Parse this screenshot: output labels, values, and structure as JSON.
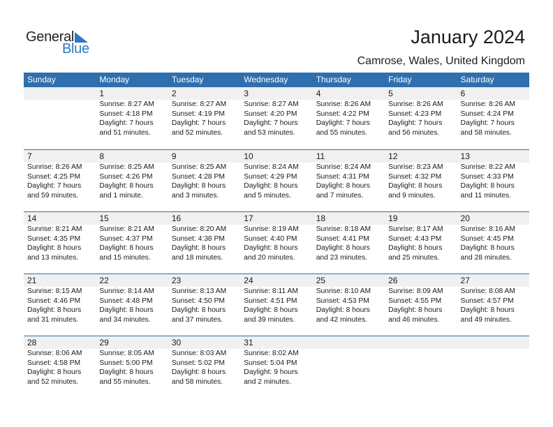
{
  "logo": {
    "general": "General",
    "blue": "Blue",
    "icon": "triangle-flag-icon"
  },
  "header": {
    "title": "January 2024",
    "location": "Camrose, Wales, United Kingdom"
  },
  "weekdays": [
    "Sunday",
    "Monday",
    "Tuesday",
    "Wednesday",
    "Thursday",
    "Friday",
    "Saturday"
  ],
  "weeks": [
    [
      null,
      {
        "day": "1",
        "sunrise": "Sunrise: 8:27 AM",
        "sunset": "Sunset: 4:18 PM",
        "daylight1": "Daylight: 7 hours",
        "daylight2": "and 51 minutes."
      },
      {
        "day": "2",
        "sunrise": "Sunrise: 8:27 AM",
        "sunset": "Sunset: 4:19 PM",
        "daylight1": "Daylight: 7 hours",
        "daylight2": "and 52 minutes."
      },
      {
        "day": "3",
        "sunrise": "Sunrise: 8:27 AM",
        "sunset": "Sunset: 4:20 PM",
        "daylight1": "Daylight: 7 hours",
        "daylight2": "and 53 minutes."
      },
      {
        "day": "4",
        "sunrise": "Sunrise: 8:26 AM",
        "sunset": "Sunset: 4:22 PM",
        "daylight1": "Daylight: 7 hours",
        "daylight2": "and 55 minutes."
      },
      {
        "day": "5",
        "sunrise": "Sunrise: 8:26 AM",
        "sunset": "Sunset: 4:23 PM",
        "daylight1": "Daylight: 7 hours",
        "daylight2": "and 56 minutes."
      },
      {
        "day": "6",
        "sunrise": "Sunrise: 8:26 AM",
        "sunset": "Sunset: 4:24 PM",
        "daylight1": "Daylight: 7 hours",
        "daylight2": "and 58 minutes."
      }
    ],
    [
      {
        "day": "7",
        "sunrise": "Sunrise: 8:26 AM",
        "sunset": "Sunset: 4:25 PM",
        "daylight1": "Daylight: 7 hours",
        "daylight2": "and 59 minutes."
      },
      {
        "day": "8",
        "sunrise": "Sunrise: 8:25 AM",
        "sunset": "Sunset: 4:26 PM",
        "daylight1": "Daylight: 8 hours",
        "daylight2": "and 1 minute."
      },
      {
        "day": "9",
        "sunrise": "Sunrise: 8:25 AM",
        "sunset": "Sunset: 4:28 PM",
        "daylight1": "Daylight: 8 hours",
        "daylight2": "and 3 minutes."
      },
      {
        "day": "10",
        "sunrise": "Sunrise: 8:24 AM",
        "sunset": "Sunset: 4:29 PM",
        "daylight1": "Daylight: 8 hours",
        "daylight2": "and 5 minutes."
      },
      {
        "day": "11",
        "sunrise": "Sunrise: 8:24 AM",
        "sunset": "Sunset: 4:31 PM",
        "daylight1": "Daylight: 8 hours",
        "daylight2": "and 7 minutes."
      },
      {
        "day": "12",
        "sunrise": "Sunrise: 8:23 AM",
        "sunset": "Sunset: 4:32 PM",
        "daylight1": "Daylight: 8 hours",
        "daylight2": "and 9 minutes."
      },
      {
        "day": "13",
        "sunrise": "Sunrise: 8:22 AM",
        "sunset": "Sunset: 4:33 PM",
        "daylight1": "Daylight: 8 hours",
        "daylight2": "and 11 minutes."
      }
    ],
    [
      {
        "day": "14",
        "sunrise": "Sunrise: 8:21 AM",
        "sunset": "Sunset: 4:35 PM",
        "daylight1": "Daylight: 8 hours",
        "daylight2": "and 13 minutes."
      },
      {
        "day": "15",
        "sunrise": "Sunrise: 8:21 AM",
        "sunset": "Sunset: 4:37 PM",
        "daylight1": "Daylight: 8 hours",
        "daylight2": "and 15 minutes."
      },
      {
        "day": "16",
        "sunrise": "Sunrise: 8:20 AM",
        "sunset": "Sunset: 4:38 PM",
        "daylight1": "Daylight: 8 hours",
        "daylight2": "and 18 minutes."
      },
      {
        "day": "17",
        "sunrise": "Sunrise: 8:19 AM",
        "sunset": "Sunset: 4:40 PM",
        "daylight1": "Daylight: 8 hours",
        "daylight2": "and 20 minutes."
      },
      {
        "day": "18",
        "sunrise": "Sunrise: 8:18 AM",
        "sunset": "Sunset: 4:41 PM",
        "daylight1": "Daylight: 8 hours",
        "daylight2": "and 23 minutes."
      },
      {
        "day": "19",
        "sunrise": "Sunrise: 8:17 AM",
        "sunset": "Sunset: 4:43 PM",
        "daylight1": "Daylight: 8 hours",
        "daylight2": "and 25 minutes."
      },
      {
        "day": "20",
        "sunrise": "Sunrise: 8:16 AM",
        "sunset": "Sunset: 4:45 PM",
        "daylight1": "Daylight: 8 hours",
        "daylight2": "and 28 minutes."
      }
    ],
    [
      {
        "day": "21",
        "sunrise": "Sunrise: 8:15 AM",
        "sunset": "Sunset: 4:46 PM",
        "daylight1": "Daylight: 8 hours",
        "daylight2": "and 31 minutes."
      },
      {
        "day": "22",
        "sunrise": "Sunrise: 8:14 AM",
        "sunset": "Sunset: 4:48 PM",
        "daylight1": "Daylight: 8 hours",
        "daylight2": "and 34 minutes."
      },
      {
        "day": "23",
        "sunrise": "Sunrise: 8:13 AM",
        "sunset": "Sunset: 4:50 PM",
        "daylight1": "Daylight: 8 hours",
        "daylight2": "and 37 minutes."
      },
      {
        "day": "24",
        "sunrise": "Sunrise: 8:11 AM",
        "sunset": "Sunset: 4:51 PM",
        "daylight1": "Daylight: 8 hours",
        "daylight2": "and 39 minutes."
      },
      {
        "day": "25",
        "sunrise": "Sunrise: 8:10 AM",
        "sunset": "Sunset: 4:53 PM",
        "daylight1": "Daylight: 8 hours",
        "daylight2": "and 42 minutes."
      },
      {
        "day": "26",
        "sunrise": "Sunrise: 8:09 AM",
        "sunset": "Sunset: 4:55 PM",
        "daylight1": "Daylight: 8 hours",
        "daylight2": "and 46 minutes."
      },
      {
        "day": "27",
        "sunrise": "Sunrise: 8:08 AM",
        "sunset": "Sunset: 4:57 PM",
        "daylight1": "Daylight: 8 hours",
        "daylight2": "and 49 minutes."
      }
    ],
    [
      {
        "day": "28",
        "sunrise": "Sunrise: 8:06 AM",
        "sunset": "Sunset: 4:58 PM",
        "daylight1": "Daylight: 8 hours",
        "daylight2": "and 52 minutes."
      },
      {
        "day": "29",
        "sunrise": "Sunrise: 8:05 AM",
        "sunset": "Sunset: 5:00 PM",
        "daylight1": "Daylight: 8 hours",
        "daylight2": "and 55 minutes."
      },
      {
        "day": "30",
        "sunrise": "Sunrise: 8:03 AM",
        "sunset": "Sunset: 5:02 PM",
        "daylight1": "Daylight: 8 hours",
        "daylight2": "and 58 minutes."
      },
      {
        "day": "31",
        "sunrise": "Sunrise: 8:02 AM",
        "sunset": "Sunset: 5:04 PM",
        "daylight1": "Daylight: 9 hours",
        "daylight2": "and 2 minutes."
      },
      null,
      null,
      null
    ]
  ],
  "colors": {
    "header_bg": "#2f6fae",
    "logo_blue": "#2b78c5",
    "day_row_bg": "#f0f0f0"
  }
}
